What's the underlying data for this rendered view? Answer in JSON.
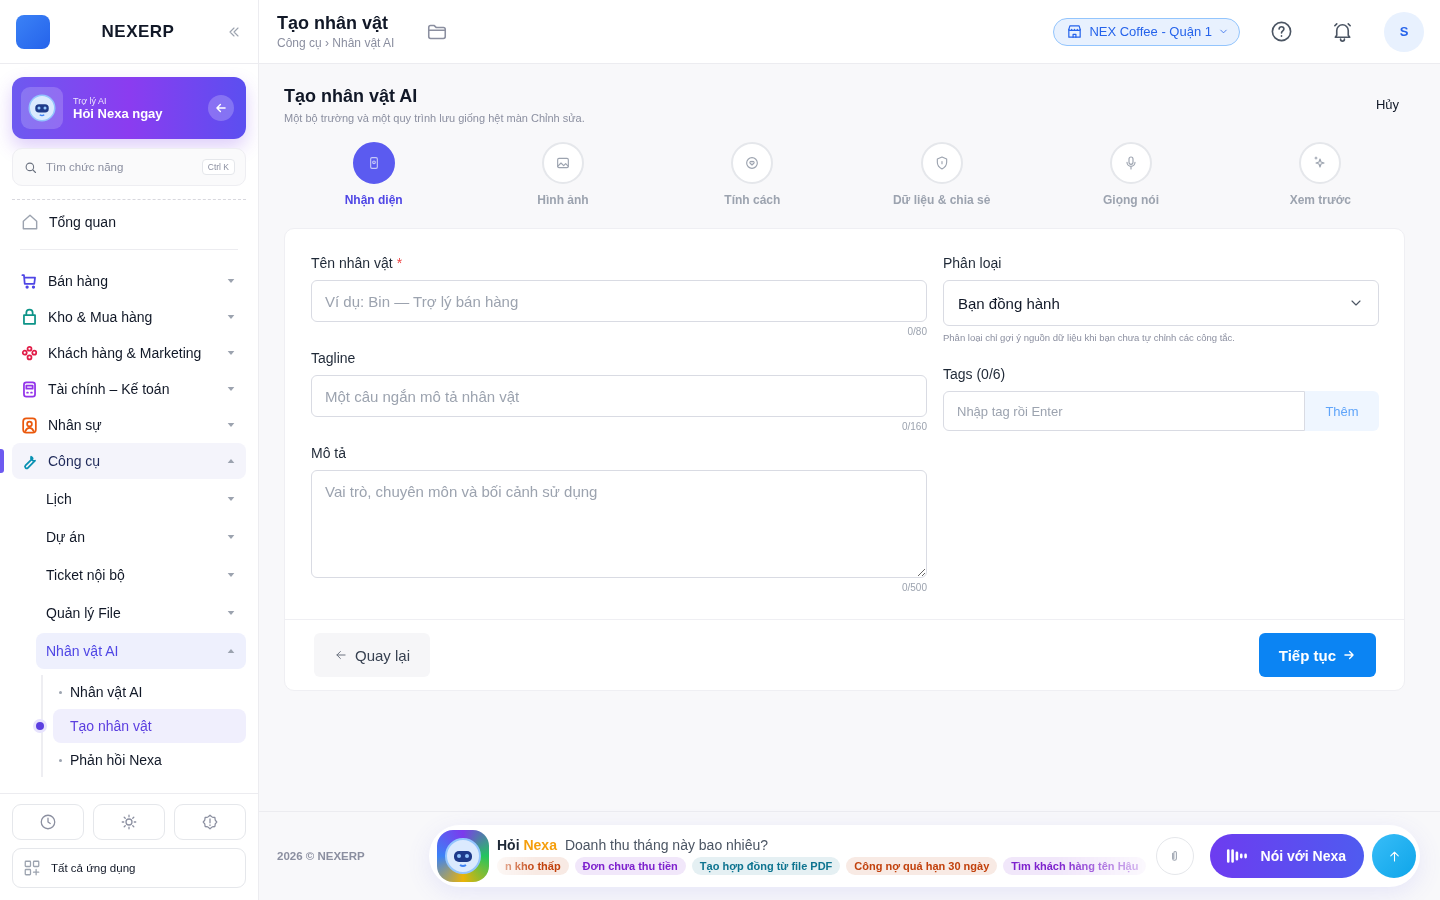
{
  "sidebar": {
    "brand": "NEXERP",
    "ai_card": {
      "label": "Trợ lý AI",
      "title": "Hỏi Nexa ngay"
    },
    "search": {
      "placeholder": "Tìm chức năng",
      "shortcut": "Ctrl K"
    },
    "overview": {
      "label": "Tổng quan",
      "selected": false
    },
    "items": [
      {
        "label": "Bán hàng",
        "color": "#4f46e5",
        "expanded": false,
        "selected": false
      },
      {
        "label": "Kho & Mua hàng",
        "color": "#0d9488",
        "expanded": false,
        "selected": false
      },
      {
        "label": "Khách hàng & Marketing",
        "color": "#e11d48",
        "expanded": false,
        "selected": false
      },
      {
        "label": "Tài chính – Kế toán",
        "color": "#9333ea",
        "expanded": false,
        "selected": false
      },
      {
        "label": "Nhân sự",
        "color": "#ea580c",
        "expanded": false,
        "selected": false
      },
      {
        "label": "Công cụ",
        "color": "#0891b2",
        "expanded": true,
        "selected": false,
        "children": [
          {
            "label": "Lịch",
            "expanded": false,
            "selected": false
          },
          {
            "label": "Dự án",
            "expanded": false,
            "selected": false
          },
          {
            "label": "Ticket nội bộ",
            "expanded": false,
            "selected": false
          },
          {
            "label": "Quản lý File",
            "expanded": false,
            "selected": false
          },
          {
            "label": "Nhân vật AI",
            "expanded": true,
            "selected": false,
            "children": [
              {
                "label": "Nhân vật AI",
                "selected": false
              },
              {
                "label": "Tạo nhân vật",
                "selected": true
              },
              {
                "label": "Phản hồi Nexa",
                "selected": false
              }
            ]
          }
        ]
      }
    ],
    "apps_button": "Tất cả ứng dụng"
  },
  "header": {
    "title": "Tạo nhân vật",
    "breadcrumb": "Công cụ › Nhân vật AI",
    "branch": "NEX Coffee - Quận 1",
    "avatar": "S"
  },
  "page": {
    "title": "Tạo nhân vật AI",
    "subtitle": "Một bộ trường và một quy trình lưu giống hệt màn Chỉnh sửa.",
    "cancel": "Hủy",
    "steps": [
      {
        "label": "Nhận diện",
        "selected": true
      },
      {
        "label": "Hình ảnh",
        "selected": false
      },
      {
        "label": "Tính cách",
        "selected": false
      },
      {
        "label": "Dữ liệu & chia sẻ",
        "selected": false
      },
      {
        "label": "Giọng nói",
        "selected": false
      },
      {
        "label": "Xem trước",
        "selected": false
      }
    ],
    "form": {
      "name": {
        "label": "Tên nhân vật",
        "required_mark": "*",
        "placeholder": "Ví dụ: Bin — Trợ lý bán hàng",
        "counter": "0/80"
      },
      "tagline": {
        "label": "Tagline",
        "placeholder": "Một câu ngắn mô tả nhân vật",
        "counter": "0/160"
      },
      "description": {
        "label": "Mô tả",
        "placeholder": "Vai trò, chuyên môn và bối cảnh sử dụng",
        "counter": "0/500"
      },
      "category": {
        "label": "Phân loại",
        "value": "Bạn đồng hành",
        "hint": "Phân loại chỉ gợi ý nguồn dữ liệu khi bạn chưa tự chỉnh các công tắc."
      },
      "tags": {
        "label": "Tags (0/6)",
        "placeholder": "Nhập tag rồi Enter",
        "button": "Thêm"
      }
    },
    "back": "Quay lại",
    "next": "Tiếp tục"
  },
  "footer": {
    "copyright": "2026 © NEXERP"
  },
  "nexa_bar": {
    "ask": "Hỏi",
    "name": "Nexa",
    "prompt": "Doanh thu tháng này bao nhiêu?",
    "suggestions": [
      {
        "label": "n kho thấp",
        "color": "#c2410c"
      },
      {
        "label": "Đơn chưa thu tiền",
        "color": "#7e22ce"
      },
      {
        "label": "Tạo hợp đồng từ file PDF",
        "color": "#0e7490"
      },
      {
        "label": "Công nợ quá hạn 30 ngày",
        "color": "#c2410c"
      },
      {
        "label": "Tìm khách hàng tên Hậu",
        "color": "#7e22ce"
      }
    ],
    "voice_button": "Nói với Nexa"
  }
}
